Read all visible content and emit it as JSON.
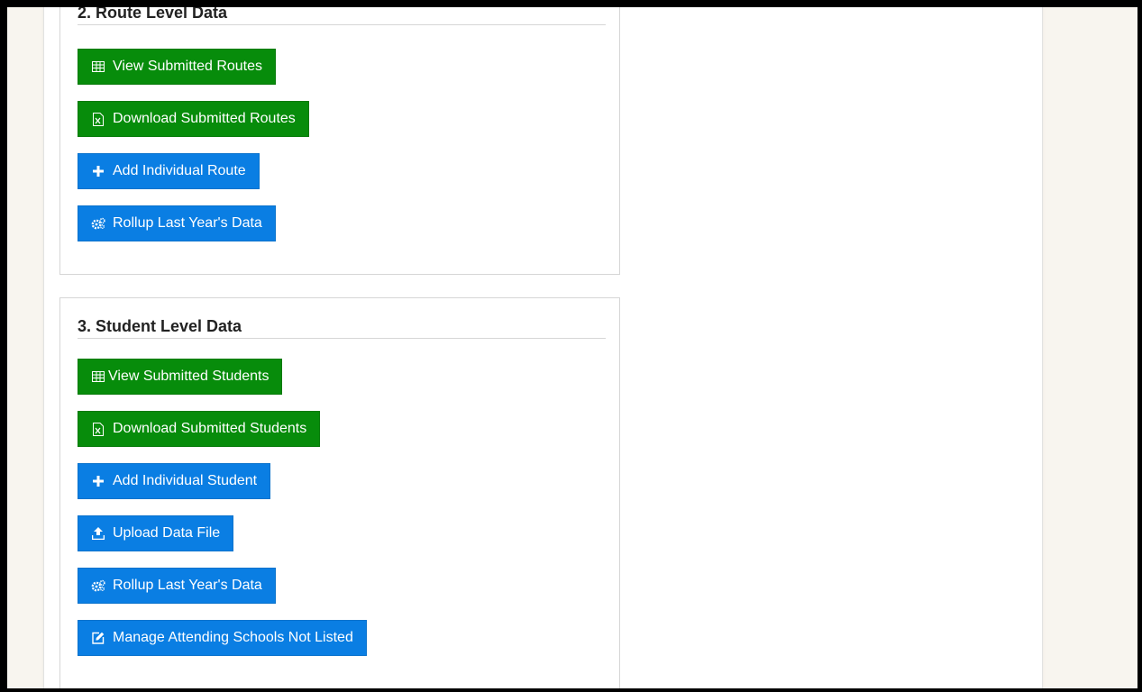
{
  "route_section": {
    "title": "2. Route Level Data",
    "buttons": {
      "view": "View Submitted Routes",
      "download": "Download Submitted Routes",
      "add": "Add Individual Route",
      "rollup": "Rollup Last Year's Data"
    }
  },
  "student_section": {
    "title": "3. Student Level Data",
    "buttons": {
      "view": "View Submitted Students",
      "download": "Download Submitted Students",
      "add": "Add Individual Student",
      "upload": "Upload Data File",
      "rollup": "Rollup Last Year's Data",
      "manage": "Manage Attending Schools Not Listed"
    }
  },
  "icons": {
    "view": "table-icon",
    "download": "excel-file-icon",
    "add": "plus-icon",
    "rollup": "gears-icon",
    "upload": "upload-icon",
    "manage": "edit-icon"
  },
  "colors": {
    "success": "#078c0b",
    "primary": "#0a7ee3",
    "page_background": "#f8f5ef",
    "frame": "#000000"
  }
}
